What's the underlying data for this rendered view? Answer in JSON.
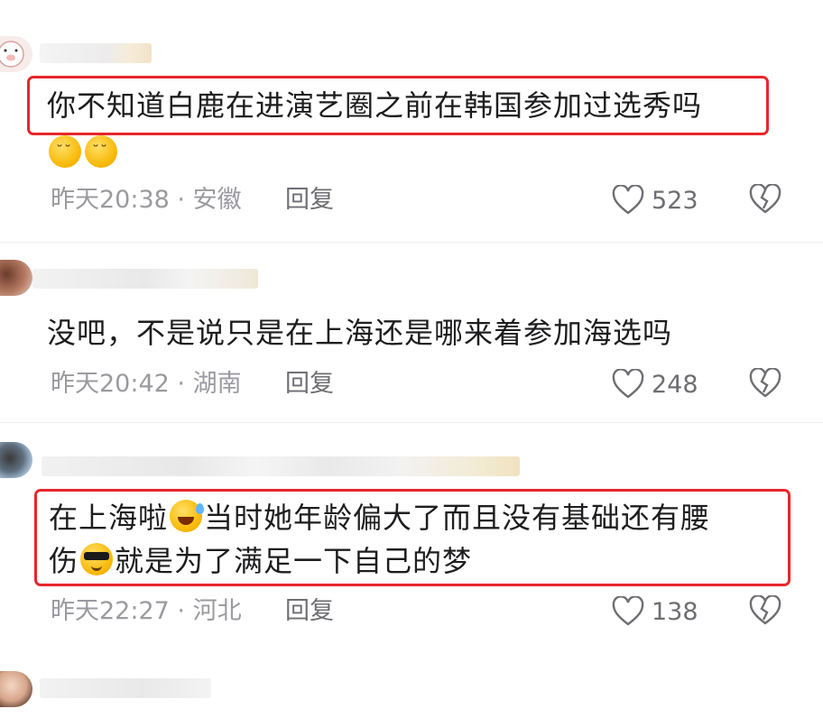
{
  "comments": [
    {
      "text_lines": [
        "你不知道白鹿在进演艺圈之前在韩国参加过选秀吗"
      ],
      "emojis": [
        "sleepy-face",
        "sleepy-face"
      ],
      "time": "昨天20:38",
      "location": "安徽",
      "separator": "·",
      "reply_label": "回复",
      "likes": "523",
      "highlighted": true
    },
    {
      "text_lines": [
        "没吧，不是说只是在上海还是哪来着参加海选吗"
      ],
      "time": "昨天20:42",
      "location": "湖南",
      "separator": "·",
      "reply_label": "回复",
      "likes": "248",
      "highlighted": false
    },
    {
      "text_parts": [
        "在上海啦",
        "当时她年龄偏大了而且没有基础还有腰",
        "伤",
        "就是为了满足一下自己的梦"
      ],
      "emojis": [
        "rolling-laugh-face",
        "sunglasses-face"
      ],
      "time": "昨天22:27",
      "location": "河北",
      "separator": "·",
      "reply_label": "回复",
      "likes": "138",
      "highlighted": true
    }
  ],
  "colors": {
    "highlight_border": "#e8262a",
    "meta_text": "#9a9aa0",
    "action_text": "#6e6e73",
    "body_text": "#1d1d1f"
  }
}
